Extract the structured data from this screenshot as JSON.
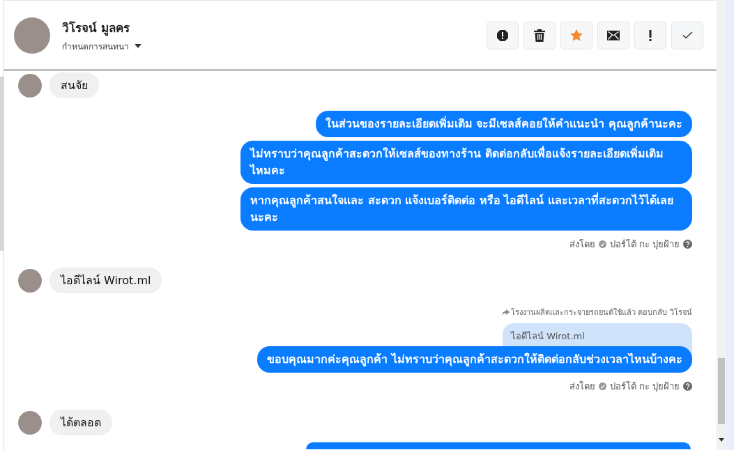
{
  "header": {
    "name": "วิโรจน์ มูลคร",
    "subtitle": "กำหนดการสนทนา"
  },
  "actions": [
    {
      "kind": "alert"
    },
    {
      "kind": "trash"
    },
    {
      "kind": "star"
    },
    {
      "kind": "mail"
    },
    {
      "kind": "exclaim"
    },
    {
      "kind": "check"
    }
  ],
  "messages": [
    {
      "kind": "incoming",
      "text": "สนจัย"
    },
    {
      "kind": "outgoing",
      "text": "ในส่วนของรายละเอียดเพิ่มเติม จะมีเซลส์คอยให้คำแนะนำ คุณลูกค้านะคะ"
    },
    {
      "kind": "outgoing",
      "text": "ไม่ทราบว่าคุณลูกค้าสะดวกให้เซลส์ของทางร้าน ติดต่อกลับเพื่อแจ้งรายละเอียดเพิ่มเติมไหมคะ"
    },
    {
      "kind": "outgoing",
      "text": "หากคุณลูกค้าสนใจและ สะดวก แจ้งเบอร์ติดต่อ หรือ ไอดีไลน์ และเวลาที่สะดวกไว้ได้เลยนะคะ"
    },
    {
      "kind": "sent_by",
      "prefix": "ส่งโดย",
      "sender": "ปอร์โต้ กะ ปุยฝ้าย"
    },
    {
      "kind": "incoming",
      "text": "ไอดีไลน์ Wirot.ml"
    },
    {
      "kind": "reply",
      "note": "โรงงานผลิตและกระจายรถยนต์ใช้แล้ว ตอบกลับ วิโรจน์",
      "quote": "ไอดีไลน์ Wirot.ml",
      "text": "ขอบคุณมากค่ะคุณลูกค้า ไม่ทราบว่าคุณลูกค้าสะดวกให้ติดต่อกลับช่วงเวลาไหนบ้างคะ"
    },
    {
      "kind": "sent_by",
      "prefix": "ส่งโดย",
      "sender": "ปอร์โต้ กะ ปุยฝ้าย"
    },
    {
      "kind": "incoming",
      "text": "ได้ตลอด"
    },
    {
      "kind": "outgoing_clipped"
    }
  ]
}
